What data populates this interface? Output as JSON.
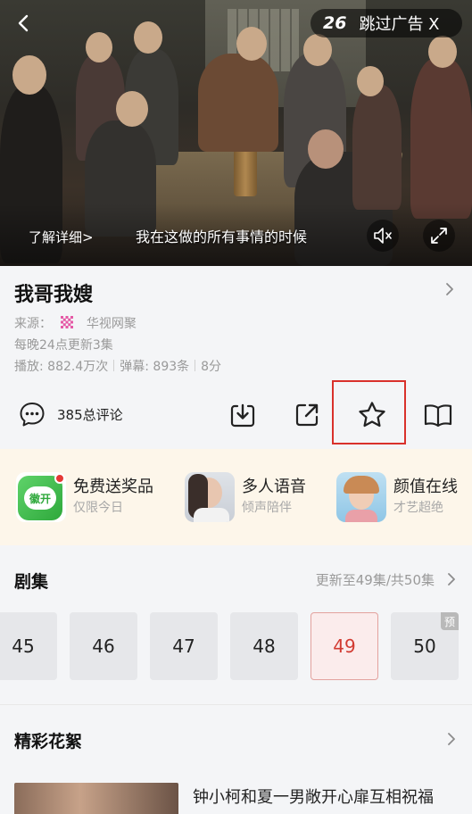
{
  "player": {
    "skip_countdown": "26",
    "skip_label": "跳过广告 X",
    "learn_more": "了解详细>",
    "subtitle": "我在这做的所有事情的时候"
  },
  "show": {
    "title": "我哥我嫂",
    "source_label": "来源：",
    "source_name": "华视网聚",
    "update_info": "每晚24点更新3集",
    "plays": "播放: 882.4万次",
    "danmaku": "弹幕: 893条",
    "score": "8分"
  },
  "actions": {
    "comments_label": "385总评论"
  },
  "promos": [
    {
      "title": "免费送奖品",
      "subtitle": "仅限今日",
      "thumb_text": "徽开"
    },
    {
      "title": "多人语音",
      "subtitle": "倾声陪伴"
    },
    {
      "title": "颜值在线",
      "subtitle": "才艺超绝"
    }
  ],
  "episodes": {
    "section_title": "剧集",
    "status": "更新至49集/共50集",
    "items": [
      {
        "num": "45",
        "active": false
      },
      {
        "num": "46",
        "active": false
      },
      {
        "num": "47",
        "active": false
      },
      {
        "num": "48",
        "active": false
      },
      {
        "num": "49",
        "active": true
      },
      {
        "num": "50",
        "active": false,
        "badge": "预"
      }
    ]
  },
  "clips": {
    "section_title": "精彩花絮",
    "first_title": "钟小柯和夏一男敞开心扉互相祝福"
  },
  "colors": {
    "accent_red": "#d23b32",
    "promo_bg": "#fdf6ea",
    "app_green": "#3cbf4a"
  }
}
